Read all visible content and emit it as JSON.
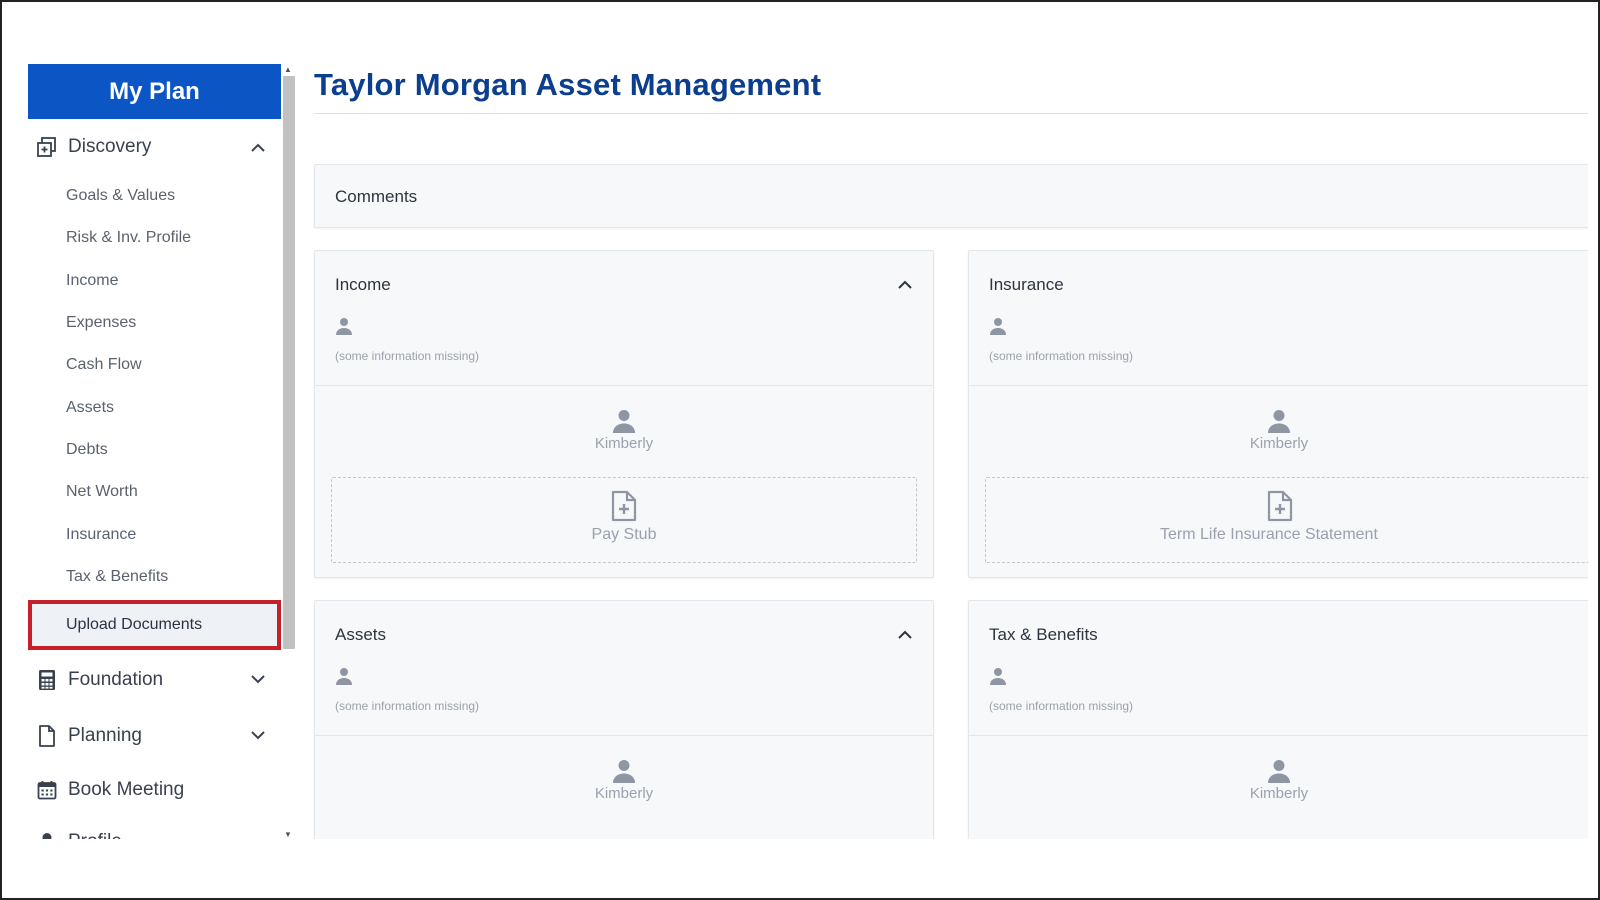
{
  "sidebar": {
    "header": "My Plan",
    "discovery": {
      "label": "Discovery",
      "items": [
        "Goals & Values",
        "Risk & Inv. Profile",
        "Income",
        "Expenses",
        "Cash Flow",
        "Assets",
        "Debts",
        "Net Worth",
        "Insurance",
        "Tax & Benefits",
        "Upload Documents"
      ],
      "active": "Upload Documents"
    },
    "foundation": "Foundation",
    "planning": "Planning",
    "book_meeting": "Book Meeting",
    "profile": "Profile"
  },
  "main": {
    "title": "Taylor Morgan Asset Management",
    "comments": "Comments",
    "cards": [
      {
        "title": "Income",
        "missing": "(some information missing)",
        "member": "Kimberly",
        "document": "Pay Stub"
      },
      {
        "title": "Insurance",
        "missing": "(some information missing)",
        "member": "Kimberly",
        "document": "Term Life Insurance Statement"
      },
      {
        "title": "Assets",
        "missing": "(some information missing)",
        "member": "Kimberly"
      },
      {
        "title": "Tax & Benefits",
        "missing": "(some information missing)",
        "member": "Kimberly"
      }
    ]
  },
  "colors": {
    "brand": "#0b56c4",
    "title": "#0b3e8e",
    "highlight": "#c8202a"
  }
}
